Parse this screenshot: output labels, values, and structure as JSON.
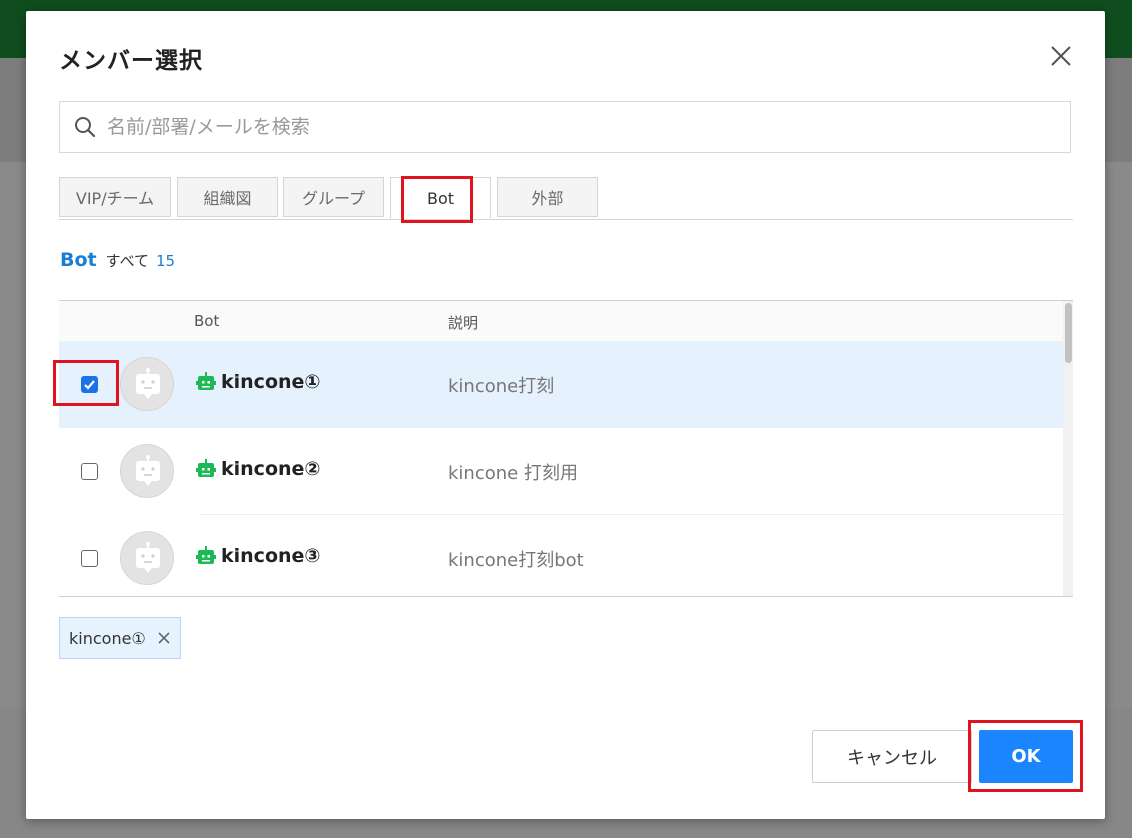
{
  "dialog": {
    "title": "メンバー選択"
  },
  "search": {
    "placeholder": "名前/部署/メールを検索"
  },
  "tabs": [
    {
      "label": "VIP/チーム",
      "active": false
    },
    {
      "label": "組織図",
      "active": false
    },
    {
      "label": "グループ",
      "active": false
    },
    {
      "label": "Bot",
      "active": true
    },
    {
      "label": "外部",
      "active": false
    }
  ],
  "section": {
    "title": "Bot",
    "all_label": "すべて",
    "count": "15"
  },
  "table": {
    "columns": {
      "bot": "Bot",
      "description": "説明"
    },
    "rows": [
      {
        "name": "kincone①",
        "description": "kincone打刻",
        "checked": true
      },
      {
        "name": "kincone②",
        "description": "kincone 打刻用",
        "checked": false
      },
      {
        "name": "kincone③",
        "description": "kincone打刻bot",
        "checked": false
      }
    ]
  },
  "selected_chips": [
    {
      "label": "kincone①"
    }
  ],
  "footer": {
    "cancel_label": "キャンセル",
    "ok_label": "OK"
  },
  "colors": {
    "accent": "#1a85ff",
    "link": "#1a7fd4",
    "highlight": "#e0141e",
    "bot_icon": "#1db954",
    "selected_row": "#e5f1fd"
  },
  "icons": {
    "search": "search-icon",
    "close": "close-icon",
    "bot": "bot-icon",
    "avatar": "robot-avatar-icon",
    "remove": "remove-icon"
  }
}
